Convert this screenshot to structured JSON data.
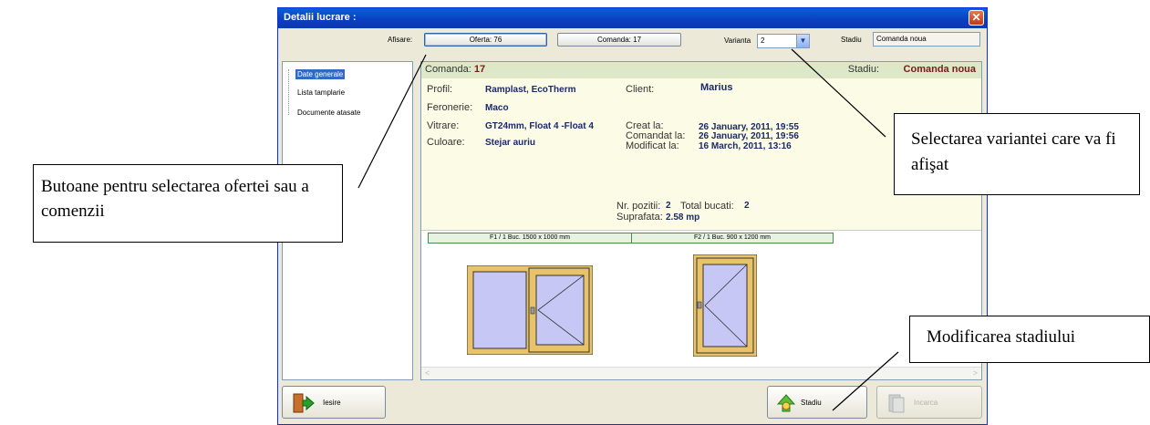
{
  "window": {
    "title": "Detalii lucrare :",
    "close_icon": "x-icon"
  },
  "toolbar": {
    "afisare_label": "Afisare:",
    "oferta_button": "Oferta: 76",
    "comanda_button": "Comanda: 17",
    "varianta_label": "Varianta",
    "varianta_value": "2",
    "stadiu_label": "Stadiu",
    "stadiu_value": "Comanda noua"
  },
  "nav": {
    "items": [
      "Date generale",
      "Lista tamplarie",
      "Documente atasate"
    ],
    "selected_index": 0
  },
  "details": {
    "comanda_label": "Comanda:",
    "comanda_value": "17",
    "stadiu_label": "Stadiu:",
    "stadiu_value": "Comanda noua",
    "profil_label": "Profil:",
    "profil_value": "Ramplast, EcoTherm",
    "feronerie_label": "Feronerie:",
    "feronerie_value": "Maco",
    "vitrare_label": "Vitrare:",
    "vitrare_value": "GT24mm, Float 4 -Float 4",
    "culoare_label": "Culoare:",
    "culoare_value": "Stejar auriu",
    "client_label": "Client:",
    "client_value": "Marius",
    "creat_label": "Creat la:",
    "creat_value": "26 January, 2011, 19:55",
    "comandat_label": "Comandat la:",
    "comandat_value": "26 January, 2011, 19:56",
    "modificat_label": "Modificat la:",
    "modificat_value": "16 March, 2011, 13:16",
    "nr_pozitii_label": "Nr. pozitii:",
    "nr_pozitii_value": "2",
    "total_bucati_label": "Total bucati:",
    "total_bucati_value": "2",
    "suprafata_label": "Suprafata:",
    "suprafata_value": "2.58 mp"
  },
  "windows_preview": [
    {
      "label": "F1 / 1 Buc.  1500 x 1000 mm"
    },
    {
      "label": "F2 / 1 Buc.  900 x 1200 mm"
    }
  ],
  "buttons": {
    "iesire": "Iesire",
    "stadiu": "Stadiu",
    "incarca": "Incarca"
  },
  "annotations": {
    "butoane": "Butoane pentru selectarea ofertei sau a comenzii",
    "selectarea": "Selectarea variantei care va fi afişat",
    "modificarea": "Modificarea stadiului"
  },
  "colors": {
    "titlebar": "#0a3fbf",
    "accent_dark_red": "#7a1a1a",
    "frame_gold": "#e8c36a",
    "glass": "#c7c7f5"
  }
}
